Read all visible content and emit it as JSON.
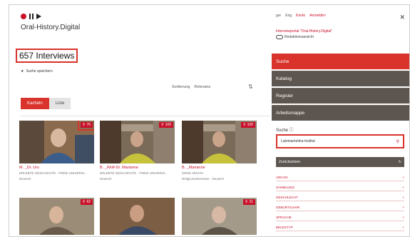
{
  "header": {
    "brand": "Oral-History.Digital"
  },
  "results": {
    "count_label": "657 Interviews",
    "save_search": "Suche speichern"
  },
  "sort": {
    "label": "Sortierung",
    "value": "Relevanz"
  },
  "view": {
    "grid": "Kacheln",
    "list": "Liste"
  },
  "cards": [
    {
      "badge": "76",
      "title": "M.           _Dr. Urs",
      "sub1": "ERLEBTE GESCHICHTE · FREIE UNIVERSI...",
      "sub2": "Deutsch"
    },
    {
      "badge": "100",
      "title": "B.    _Wolf-Dr. Marianne",
      "sub1": "ERLEBTE GESCHICHTE · FREIE UNIVERSI...",
      "sub2": "Deutsch"
    },
    {
      "badge": "100",
      "title": "B.    _Marianne",
      "sub1": "ZONE ARCHIV",
      "sub2": "Religionsinterviews · Deutsch"
    },
    {
      "badge": "62"
    },
    {
      "badge": ""
    },
    {
      "badge": "21"
    }
  ],
  "sidebar": {
    "lang_de": "ger",
    "lang_en": "Eng",
    "konto": "Konto",
    "anmelden": "Anmelden",
    "close": "✕",
    "portal": "Interviewportal \"Oral-History.Digital\"",
    "editorial": "Redaktionsansicht",
    "nav": [
      "Suche",
      "Katalog",
      "Register",
      "Arbeitsmappe"
    ],
    "search_label": "Suche",
    "search_value": "Lateinamerika-Institut",
    "reset": "Zurücksetzen",
    "facets": [
      "ARCHIV",
      "SAMMLUNG",
      "GESCHLECHT",
      "GEBURTSJAHR",
      "SPRACHE",
      "BELEGTYP"
    ]
  },
  "colors": {
    "accent": "#d9332b",
    "sidebar_dark": "#5d554f"
  }
}
